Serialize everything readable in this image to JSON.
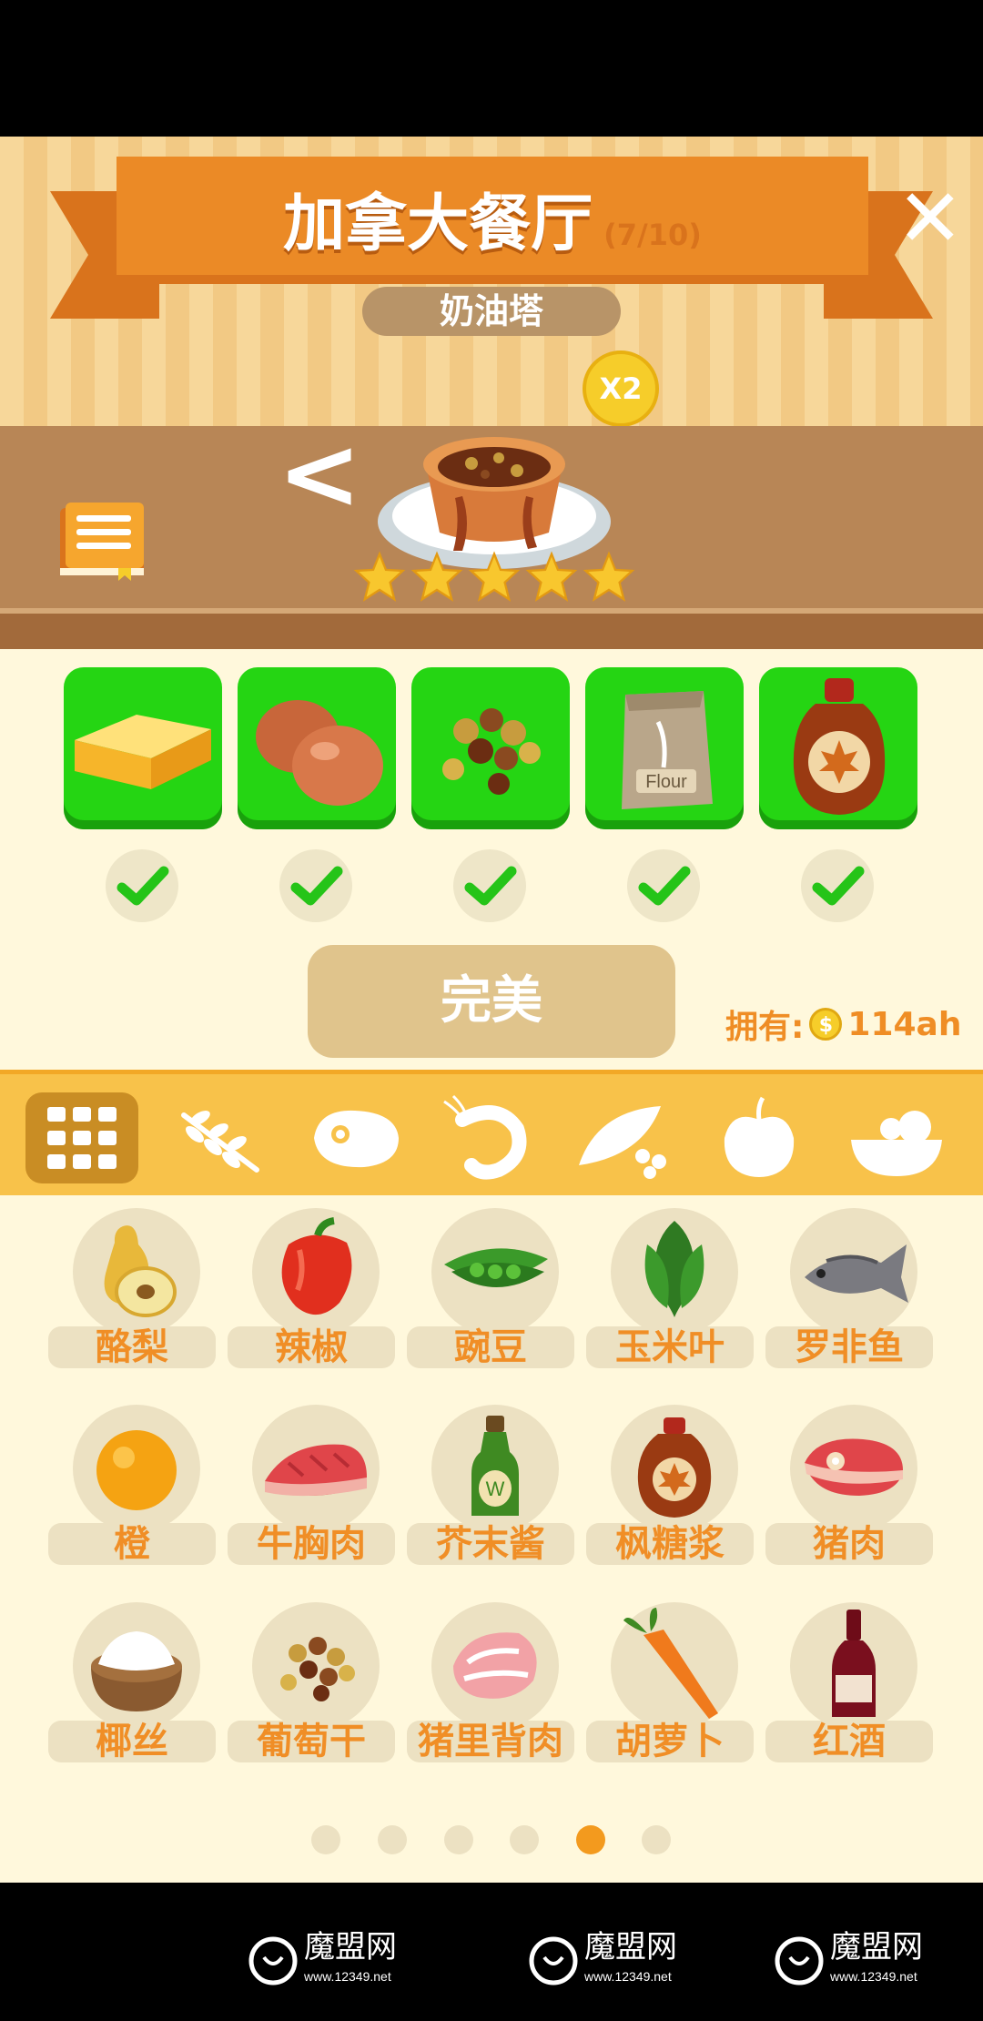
{
  "header": {
    "title": "加拿大餐厅",
    "progress": "(7/10)",
    "close_label": "✕"
  },
  "dish": {
    "name": "奶油塔",
    "multiplier": "X2",
    "stars": 5,
    "prev_label": "<"
  },
  "ingredients": [
    {
      "icon": "butter-icon",
      "checked": true
    },
    {
      "icon": "eggs-icon",
      "checked": true
    },
    {
      "icon": "raisins-icon",
      "checked": true
    },
    {
      "icon": "flour-bag-icon",
      "checked": true
    },
    {
      "icon": "maple-syrup-icon",
      "checked": true
    }
  ],
  "perfect_button": {
    "label": "完美"
  },
  "owned": {
    "label": "拥有:",
    "value": "114ah",
    "coin_symbol": "$"
  },
  "categories": [
    "grid-all-icon",
    "wheat-icon",
    "meat-icon",
    "shrimp-icon",
    "peas-icon",
    "apple-icon",
    "salad-bowl-icon"
  ],
  "items": [
    {
      "label": "酪梨",
      "icon": "pear-icon"
    },
    {
      "label": "辣椒",
      "icon": "red-pepper-icon"
    },
    {
      "label": "豌豆",
      "icon": "pea-pod-icon"
    },
    {
      "label": "玉米叶",
      "icon": "leaves-icon"
    },
    {
      "label": "罗非鱼",
      "icon": "fish-icon"
    },
    {
      "label": "橙",
      "icon": "orange-icon"
    },
    {
      "label": "牛胸肉",
      "icon": "beef-brisket-icon"
    },
    {
      "label": "芥末酱",
      "icon": "mustard-bottle-icon"
    },
    {
      "label": "枫糖浆",
      "icon": "maple-syrup-icon"
    },
    {
      "label": "猪肉",
      "icon": "pork-icon"
    },
    {
      "label": "椰丝",
      "icon": "coconut-icon"
    },
    {
      "label": "葡萄干",
      "icon": "raisins-icon"
    },
    {
      "label": "猪里背肉",
      "icon": "pork-loin-icon"
    },
    {
      "label": "胡萝卜",
      "icon": "carrot-icon"
    },
    {
      "label": "红酒",
      "icon": "wine-bottle-icon"
    }
  ],
  "pagination": {
    "total": 6,
    "active": 5
  },
  "watermark": {
    "brand": "魔盟网",
    "url": "www.12349.net"
  },
  "colors": {
    "accent_orange": "#eb8a26",
    "card_green": "#25d513",
    "label_orange": "#f08e26"
  }
}
